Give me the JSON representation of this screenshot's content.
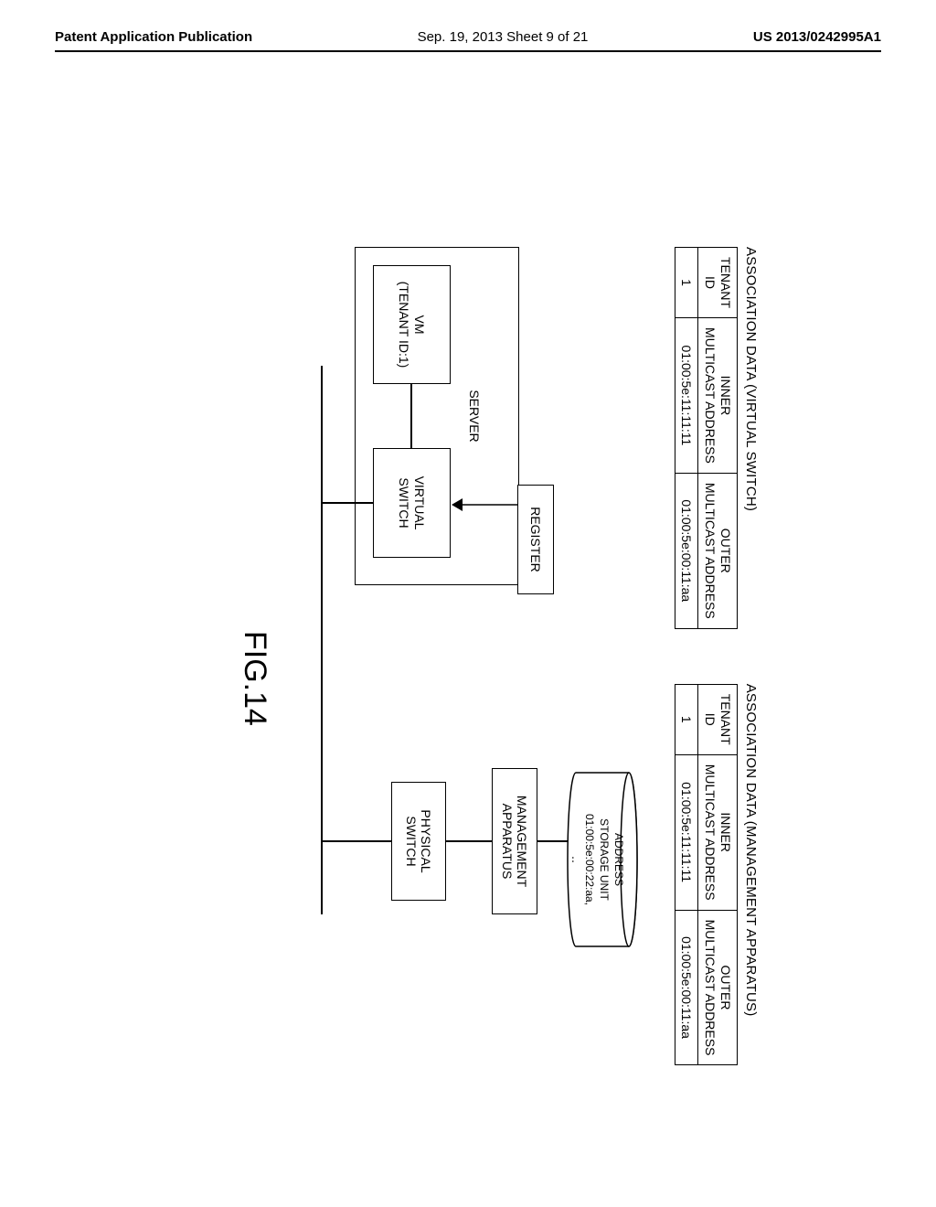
{
  "header": {
    "left": "Patent Application Publication",
    "center": "Sep. 19, 2013  Sheet 9 of 21",
    "right": "US 2013/0242995A1"
  },
  "table1": {
    "caption": "ASSOCIATION DATA (VIRTUAL SWITCH)",
    "h1a": "TENANT",
    "h1b": "ID",
    "h2a": "INNER",
    "h2b": "MULTICAST ADDRESS",
    "h3a": "OUTER",
    "h3b": "MULTICAST ADDRESS",
    "r1c1": "1",
    "r1c2": "01:00:5e:11:11:11",
    "r1c3": "01:00:5e:00:11:aa"
  },
  "table2": {
    "caption": "ASSOCIATION DATA (MANAGEMENT APPARATUS)",
    "h1a": "TENANT",
    "h1b": "ID",
    "h2a": "INNER",
    "h2b": "MULTICAST ADDRESS",
    "h3a": "OUTER",
    "h3b": "MULTICAST ADDRESS",
    "r1c1": "1",
    "r1c2": "01:00:5e:11:11:11",
    "r1c3": "01:00:5e:00:11:aa"
  },
  "diagram": {
    "server": "SERVER",
    "vm_l1": "VM",
    "vm_l2": "(TENANT ID:1)",
    "vswitch_l1": "VIRTUAL",
    "vswitch_l2": "SWITCH",
    "register": "REGISTER",
    "pswitch_l1": "PHYSICAL",
    "pswitch_l2": "SWITCH",
    "mgmt_l1": "MANAGEMENT",
    "mgmt_l2": "APPARATUS",
    "storage_l1": "ADDRESS",
    "storage_l2": "STORAGE UNIT",
    "storage_l3": "01:00:5e:00:22:aa,",
    "storage_l4": "‥"
  },
  "figure_label": "FIG.14"
}
